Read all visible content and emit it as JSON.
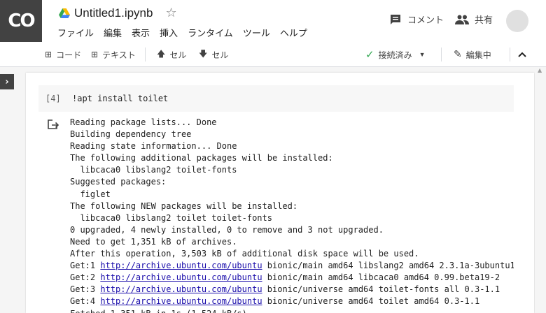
{
  "app": {
    "logo_text": "CO"
  },
  "header": {
    "title": "Untitled1.ipynb",
    "menu": [
      "ファイル",
      "編集",
      "表示",
      "挿入",
      "ランタイム",
      "ツール",
      "ヘルプ"
    ],
    "comment_label": "コメント",
    "share_label": "共有"
  },
  "toolbar": {
    "code_label": "コード",
    "text_label": "テキスト",
    "cell_up_label": "セル",
    "cell_down_label": "セル",
    "connection_label": "接続済み",
    "edit_mode_label": "編集中"
  },
  "cell": {
    "execution_count": "[4]",
    "source": "!apt install toilet"
  },
  "output": {
    "lines": [
      {
        "text": "Reading package lists... Done"
      },
      {
        "text": "Building dependency tree"
      },
      {
        "text": "Reading state information... Done"
      },
      {
        "text": "The following additional packages will be installed:"
      },
      {
        "text": "  libcaca0 libslang2 toilet-fonts"
      },
      {
        "text": "Suggested packages:"
      },
      {
        "text": "  figlet"
      },
      {
        "text": "The following NEW packages will be installed:"
      },
      {
        "text": "  libcaca0 libslang2 toilet toilet-fonts"
      },
      {
        "text": "0 upgraded, 4 newly installed, 0 to remove and 3 not upgraded."
      },
      {
        "text": "Need to get 1,351 kB of archives."
      },
      {
        "text": "After this operation, 3,503 kB of additional disk space will be used."
      },
      {
        "prefix": "Get:1 ",
        "link": "http://archive.ubuntu.com/ubuntu",
        "suffix": " bionic/main amd64 libslang2 amd64 2.3.1a-3ubuntu1"
      },
      {
        "prefix": "Get:2 ",
        "link": "http://archive.ubuntu.com/ubuntu",
        "suffix": " bionic/main amd64 libcaca0 amd64 0.99.beta19-2"
      },
      {
        "prefix": "Get:3 ",
        "link": "http://archive.ubuntu.com/ubuntu",
        "suffix": " bionic/universe amd64 toilet-fonts all 0.3-1.1"
      },
      {
        "prefix": "Get:4 ",
        "link": "http://archive.ubuntu.com/ubuntu",
        "suffix": " bionic/universe amd64 toilet amd64 0.3-1.1"
      },
      {
        "text": "Fetched 1,351 kB in 1s (1,524 kB/s)"
      }
    ]
  },
  "colors": {
    "accent_dark": "#424242",
    "link": "#1a0dab",
    "connected": "#34a853"
  }
}
